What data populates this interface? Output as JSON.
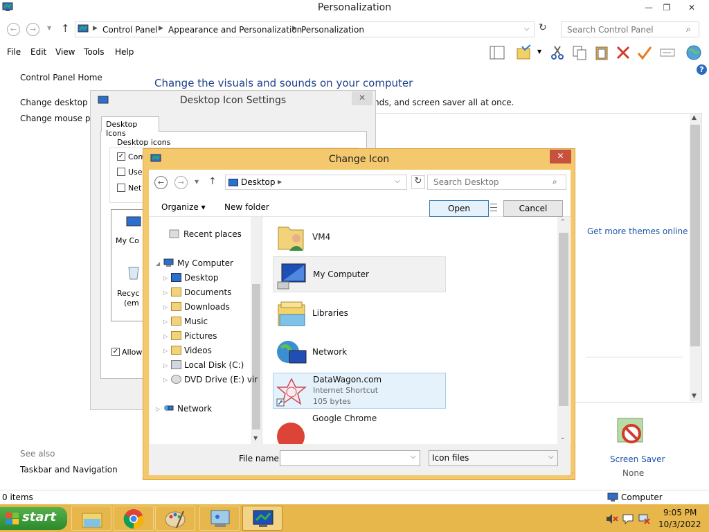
{
  "window": {
    "title": "Personalization",
    "minimize": "—",
    "maximize": "❐",
    "close": "✕"
  },
  "address": {
    "crumbs": [
      "Control Panel",
      "Appearance and Personalization",
      "Personalization"
    ],
    "search_placeholder": "Search Control Panel"
  },
  "menu": [
    "File",
    "Edit",
    "View",
    "Tools",
    "Help"
  ],
  "left_nav": {
    "home": "Control Panel Home",
    "desktop_icons": "Change desktop ic",
    "mouse_pointers": "Change mouse poi",
    "see_also": "See also",
    "taskbar": "Taskbar and Navigation"
  },
  "main": {
    "heading": "Change the visuals and sounds on your computer",
    "subtext": "nds, and screen saver all at once.",
    "get_more_themes": "Get more themes online",
    "screen_saver_label": "Screen Saver",
    "screen_saver_value": "None"
  },
  "status": {
    "items": "0 items",
    "computer": "Computer"
  },
  "desktop_icon_settings": {
    "title": "Desktop Icon Settings",
    "tab": "Desktop Icons",
    "group": "Desktop icons",
    "checkboxes": [
      {
        "label": "Com",
        "checked": true
      },
      {
        "label": "Use",
        "checked": false
      },
      {
        "label": "Net",
        "checked": false
      }
    ],
    "icons": [
      "My Co",
      "Recyc",
      "(em"
    ],
    "allow": "Allow"
  },
  "change_icon": {
    "title": "Change Icon",
    "location": "Desktop",
    "search_placeholder": "Search Desktop",
    "organize": "Organize",
    "new_folder": "New folder",
    "tree": [
      {
        "label": "Recent places",
        "level": 1,
        "arrow": ""
      },
      {
        "label": "My Computer",
        "level": 0,
        "arrow": "◢"
      },
      {
        "label": "Desktop",
        "level": 1,
        "arrow": "▷"
      },
      {
        "label": "Documents",
        "level": 1,
        "arrow": "▷"
      },
      {
        "label": "Downloads",
        "level": 1,
        "arrow": "▷"
      },
      {
        "label": "Music",
        "level": 1,
        "arrow": "▷"
      },
      {
        "label": "Pictures",
        "level": 1,
        "arrow": "▷"
      },
      {
        "label": "Videos",
        "level": 1,
        "arrow": "▷"
      },
      {
        "label": "Local Disk (C:)",
        "level": 1,
        "arrow": "▷"
      },
      {
        "label": "DVD Drive (E:) vir",
        "level": 1,
        "arrow": "▷"
      },
      {
        "label": "Network",
        "level": 0,
        "arrow": "▷"
      }
    ],
    "files": [
      {
        "name": "VM4",
        "sub1": "",
        "sub2": "",
        "icon": "user-folder-icon"
      },
      {
        "name": "My Computer",
        "sub1": "",
        "sub2": "",
        "icon": "computer-icon"
      },
      {
        "name": "Libraries",
        "sub1": "",
        "sub2": "",
        "icon": "libraries-icon"
      },
      {
        "name": "Network",
        "sub1": "",
        "sub2": "",
        "icon": "network-icon"
      },
      {
        "name": "DataWagon.com",
        "sub1": "Internet Shortcut",
        "sub2": "105 bytes",
        "icon": "internet-shortcut-icon"
      },
      {
        "name": "Google Chrome",
        "sub1": "",
        "sub2": "",
        "icon": "chrome-icon"
      }
    ],
    "file_name_label": "File name:",
    "file_name_value": "",
    "file_type": "Icon files",
    "open": "Open",
    "cancel": "Cancel"
  },
  "taskbar": {
    "start": "start",
    "time": "9:05 PM",
    "date": "10/3/2022"
  },
  "colors": {
    "dialog_frame": "#f4c96e",
    "taskbar": "#e7b74b",
    "link": "#1e56a8",
    "close_red": "#c7503f"
  }
}
